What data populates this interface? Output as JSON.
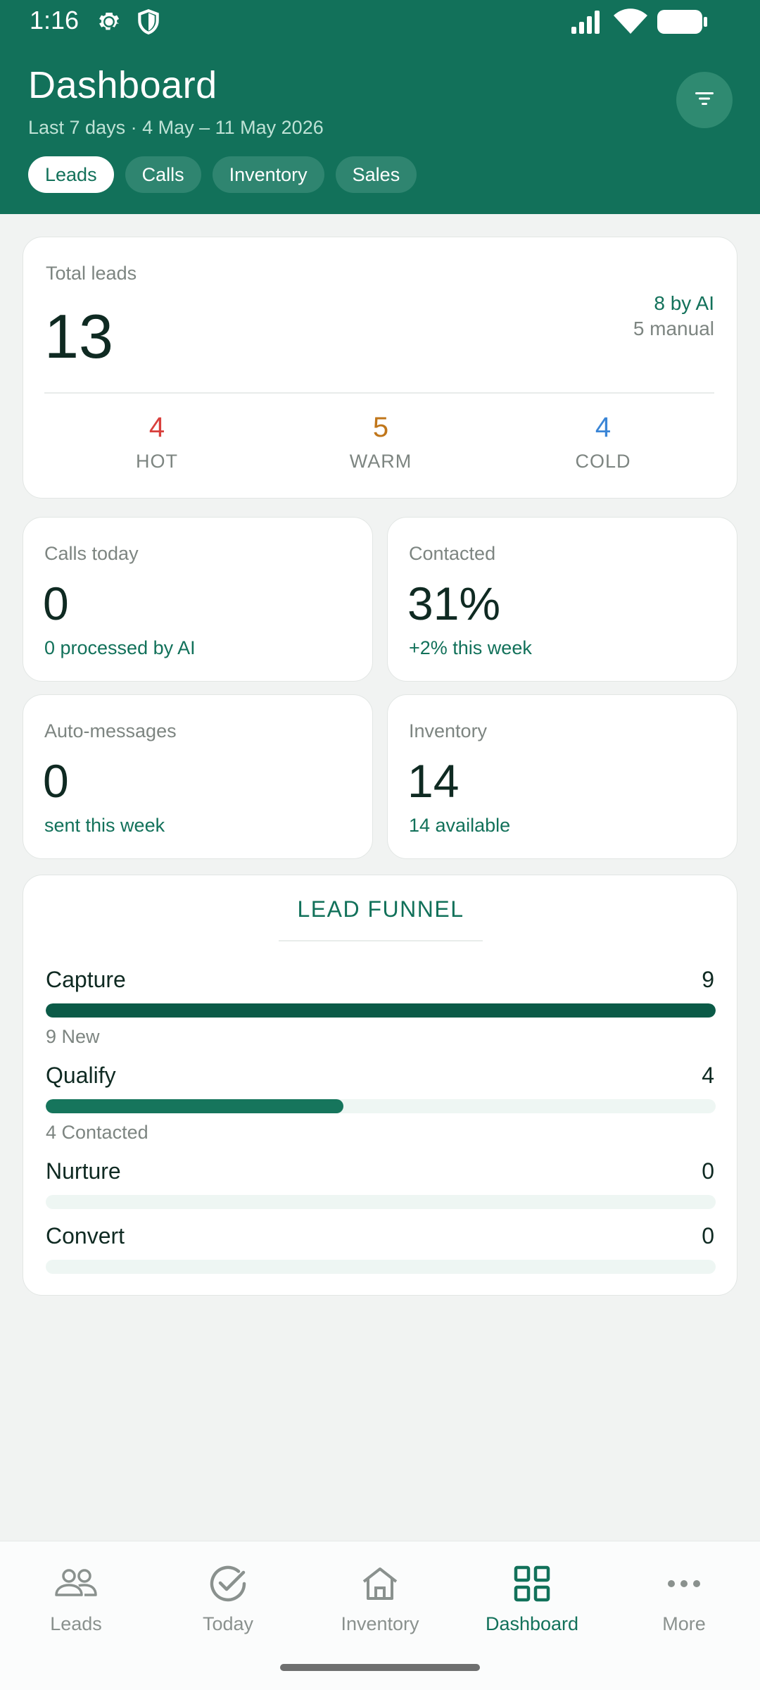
{
  "status": {
    "time": "1:16"
  },
  "header": {
    "title": "Dashboard",
    "subtitle": "Last 7 days · 4 May – 11 May 2026",
    "chips": [
      {
        "label": "Leads",
        "active": true
      },
      {
        "label": "Calls",
        "active": false
      },
      {
        "label": "Inventory",
        "active": false
      },
      {
        "label": "Sales",
        "active": false
      }
    ]
  },
  "total_leads": {
    "label": "Total leads",
    "value": "13",
    "by_ai": "8 by AI",
    "manual": "5 manual",
    "hot": {
      "value": "4",
      "label": "HOT",
      "color": "#d9403d"
    },
    "warm": {
      "value": "5",
      "label": "WARM",
      "color": "#c0761a"
    },
    "cold": {
      "value": "4",
      "label": "COLD",
      "color": "#3a85d6"
    }
  },
  "stats": {
    "calls": {
      "label": "Calls today",
      "value": "0",
      "sub": "0 processed by AI"
    },
    "contacted": {
      "label": "Contacted",
      "value": "31%",
      "sub": "+2% this week"
    },
    "auto_messages": {
      "label": "Auto-messages",
      "value": "0",
      "sub": "sent this week"
    },
    "inventory": {
      "label": "Inventory",
      "value": "14",
      "sub": "14 available"
    }
  },
  "funnel": {
    "title": "LEAD FUNNEL",
    "stages": [
      {
        "name": "Capture",
        "count": "9",
        "fraction": 1.0,
        "note": "9 New",
        "color": "#0b5a47"
      },
      {
        "name": "Qualify",
        "count": "4",
        "fraction": 0.444,
        "note": "4 Contacted",
        "color": "#16755c"
      },
      {
        "name": "Nurture",
        "count": "0",
        "fraction": 0,
        "note": "",
        "color": "#16755c"
      },
      {
        "name": "Convert",
        "count": "0",
        "fraction": 0,
        "note": "",
        "color": "#16755c"
      }
    ]
  },
  "nav": {
    "leads": "Leads",
    "today": "Today",
    "inventory": "Inventory",
    "dashboard": "Dashboard",
    "more": "More"
  },
  "colors": {
    "brand": "#12715a",
    "accent_light": "#eef6f3"
  }
}
